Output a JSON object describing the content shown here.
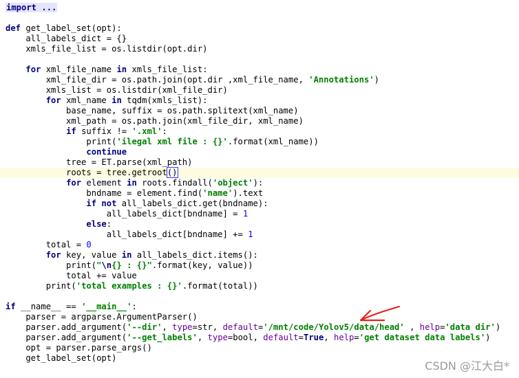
{
  "editor": {
    "lines": [
      [
        [
          "import ...",
          "fold"
        ]
      ],
      [],
      [
        [
          "def ",
          "kw"
        ],
        [
          "get_label_set(opt):",
          ""
        ]
      ],
      [
        [
          "    all_labels_dict = {}",
          ""
        ]
      ],
      [
        [
          "    xmls_file_list = os.listdir(opt.dir)",
          ""
        ]
      ],
      [],
      [
        [
          "    ",
          ""
        ],
        [
          "for ",
          "kw"
        ],
        [
          "xml_file_name ",
          ""
        ],
        [
          "in ",
          "kw"
        ],
        [
          "xmls_file_list:",
          ""
        ]
      ],
      [
        [
          "        xml_file_dir = os.path.join(opt.dir ,xml_file_name, ",
          ""
        ],
        [
          "'Annotations'",
          "str"
        ],
        [
          ")",
          ""
        ]
      ],
      [
        [
          "        xmls_list = os.listdir(xml_file_dir)",
          ""
        ]
      ],
      [
        [
          "        ",
          ""
        ],
        [
          "for ",
          "kw"
        ],
        [
          "xml_name ",
          ""
        ],
        [
          "in ",
          "kw"
        ],
        [
          "tqdm(xmls_list):",
          ""
        ]
      ],
      [
        [
          "            base_name, suffix = os.path.splitext(xml_name)",
          ""
        ]
      ],
      [
        [
          "            xml_path = os.path.join(xml_file_dir, xml_name)",
          ""
        ]
      ],
      [
        [
          "            ",
          ""
        ],
        [
          "if ",
          "kw"
        ],
        [
          "suffix != ",
          ""
        ],
        [
          "'.xml'",
          "str"
        ],
        [
          ":",
          ""
        ]
      ],
      [
        [
          "                print(",
          ""
        ],
        [
          "'ilegal xml file : {}'",
          "str"
        ],
        [
          ".format(xml_name))",
          ""
        ]
      ],
      [
        [
          "                ",
          ""
        ],
        [
          "continue",
          "kw"
        ]
      ],
      [
        [
          "            tree = ET.parse(xml_path)",
          ""
        ]
      ],
      [
        [
          "            roots = tree.getroot",
          ""
        ],
        [
          "()",
          "caret-box"
        ],
        [
          "",
          "caret"
        ]
      ],
      [
        [
          "            ",
          ""
        ],
        [
          "for ",
          "kw"
        ],
        [
          "element ",
          ""
        ],
        [
          "in ",
          "kw"
        ],
        [
          "roots.findall(",
          ""
        ],
        [
          "'object'",
          "str"
        ],
        [
          "):",
          ""
        ]
      ],
      [
        [
          "                bndname = element.find(",
          ""
        ],
        [
          "'name'",
          "str"
        ],
        [
          ").text",
          ""
        ]
      ],
      [
        [
          "                ",
          ""
        ],
        [
          "if not ",
          "kw"
        ],
        [
          "all_labels_dict.get(bndname):",
          ""
        ]
      ],
      [
        [
          "                    all_labels_dict[bndname] = ",
          ""
        ],
        [
          "1",
          "num"
        ]
      ],
      [
        [
          "                ",
          ""
        ],
        [
          "else",
          "kw"
        ],
        [
          ":",
          ""
        ]
      ],
      [
        [
          "                    all_labels_dict[bndname] += ",
          ""
        ],
        [
          "1",
          "num"
        ]
      ],
      [
        [
          "        total = ",
          ""
        ],
        [
          "0",
          "num"
        ]
      ],
      [
        [
          "        ",
          ""
        ],
        [
          "for ",
          "kw"
        ],
        [
          "key, value ",
          ""
        ],
        [
          "in ",
          "kw"
        ],
        [
          "all_labels_dict.items():",
          ""
        ]
      ],
      [
        [
          "            print(",
          ""
        ],
        [
          "\"",
          "str"
        ],
        [
          "\\n",
          "esc"
        ],
        [
          "{} : {}\"",
          "str"
        ],
        [
          ".format(key, value))",
          ""
        ]
      ],
      [
        [
          "            total += value",
          ""
        ]
      ],
      [
        [
          "        print(",
          ""
        ],
        [
          "'total examples : {}'",
          "str"
        ],
        [
          ".format(total))",
          ""
        ]
      ],
      [],
      [
        [
          "if ",
          "kw"
        ],
        [
          "__name__ == ",
          ""
        ],
        [
          "'__main__'",
          "str"
        ],
        [
          ":",
          ""
        ]
      ],
      [
        [
          "    parser = argparse.ArgumentParser()",
          ""
        ]
      ],
      [
        [
          "    parser.add_argument(",
          ""
        ],
        [
          "'--dir'",
          "str"
        ],
        [
          ", ",
          ""
        ],
        [
          "type",
          "kwarg"
        ],
        [
          "=str, ",
          ""
        ],
        [
          "default",
          "kwarg"
        ],
        [
          "=",
          ""
        ],
        [
          "'/mnt/code/Yolov5/data/head'",
          "str"
        ],
        [
          " , ",
          ""
        ],
        [
          "help",
          "kwarg"
        ],
        [
          "=",
          ""
        ],
        [
          "'data dir'",
          "str"
        ],
        [
          ")",
          ""
        ]
      ],
      [
        [
          "    parser.add_argument(",
          ""
        ],
        [
          "'--get_labels'",
          "str"
        ],
        [
          ", ",
          ""
        ],
        [
          "type",
          "kwarg"
        ],
        [
          "=bool, ",
          ""
        ],
        [
          "default",
          "kwarg"
        ],
        [
          "=",
          ""
        ],
        [
          "True",
          "kw"
        ],
        [
          ", ",
          ""
        ],
        [
          "help",
          "kwarg"
        ],
        [
          "=",
          ""
        ],
        [
          "'get dataset data labels'",
          "str"
        ],
        [
          ")",
          ""
        ]
      ],
      [
        [
          "    opt = parser.parse_args()",
          ""
        ]
      ],
      [
        [
          "    get_label_set(opt)",
          ""
        ]
      ]
    ],
    "current_line": 16
  },
  "watermark": "CSDN @江大白*",
  "annotation": {
    "color": "#e8201a"
  }
}
